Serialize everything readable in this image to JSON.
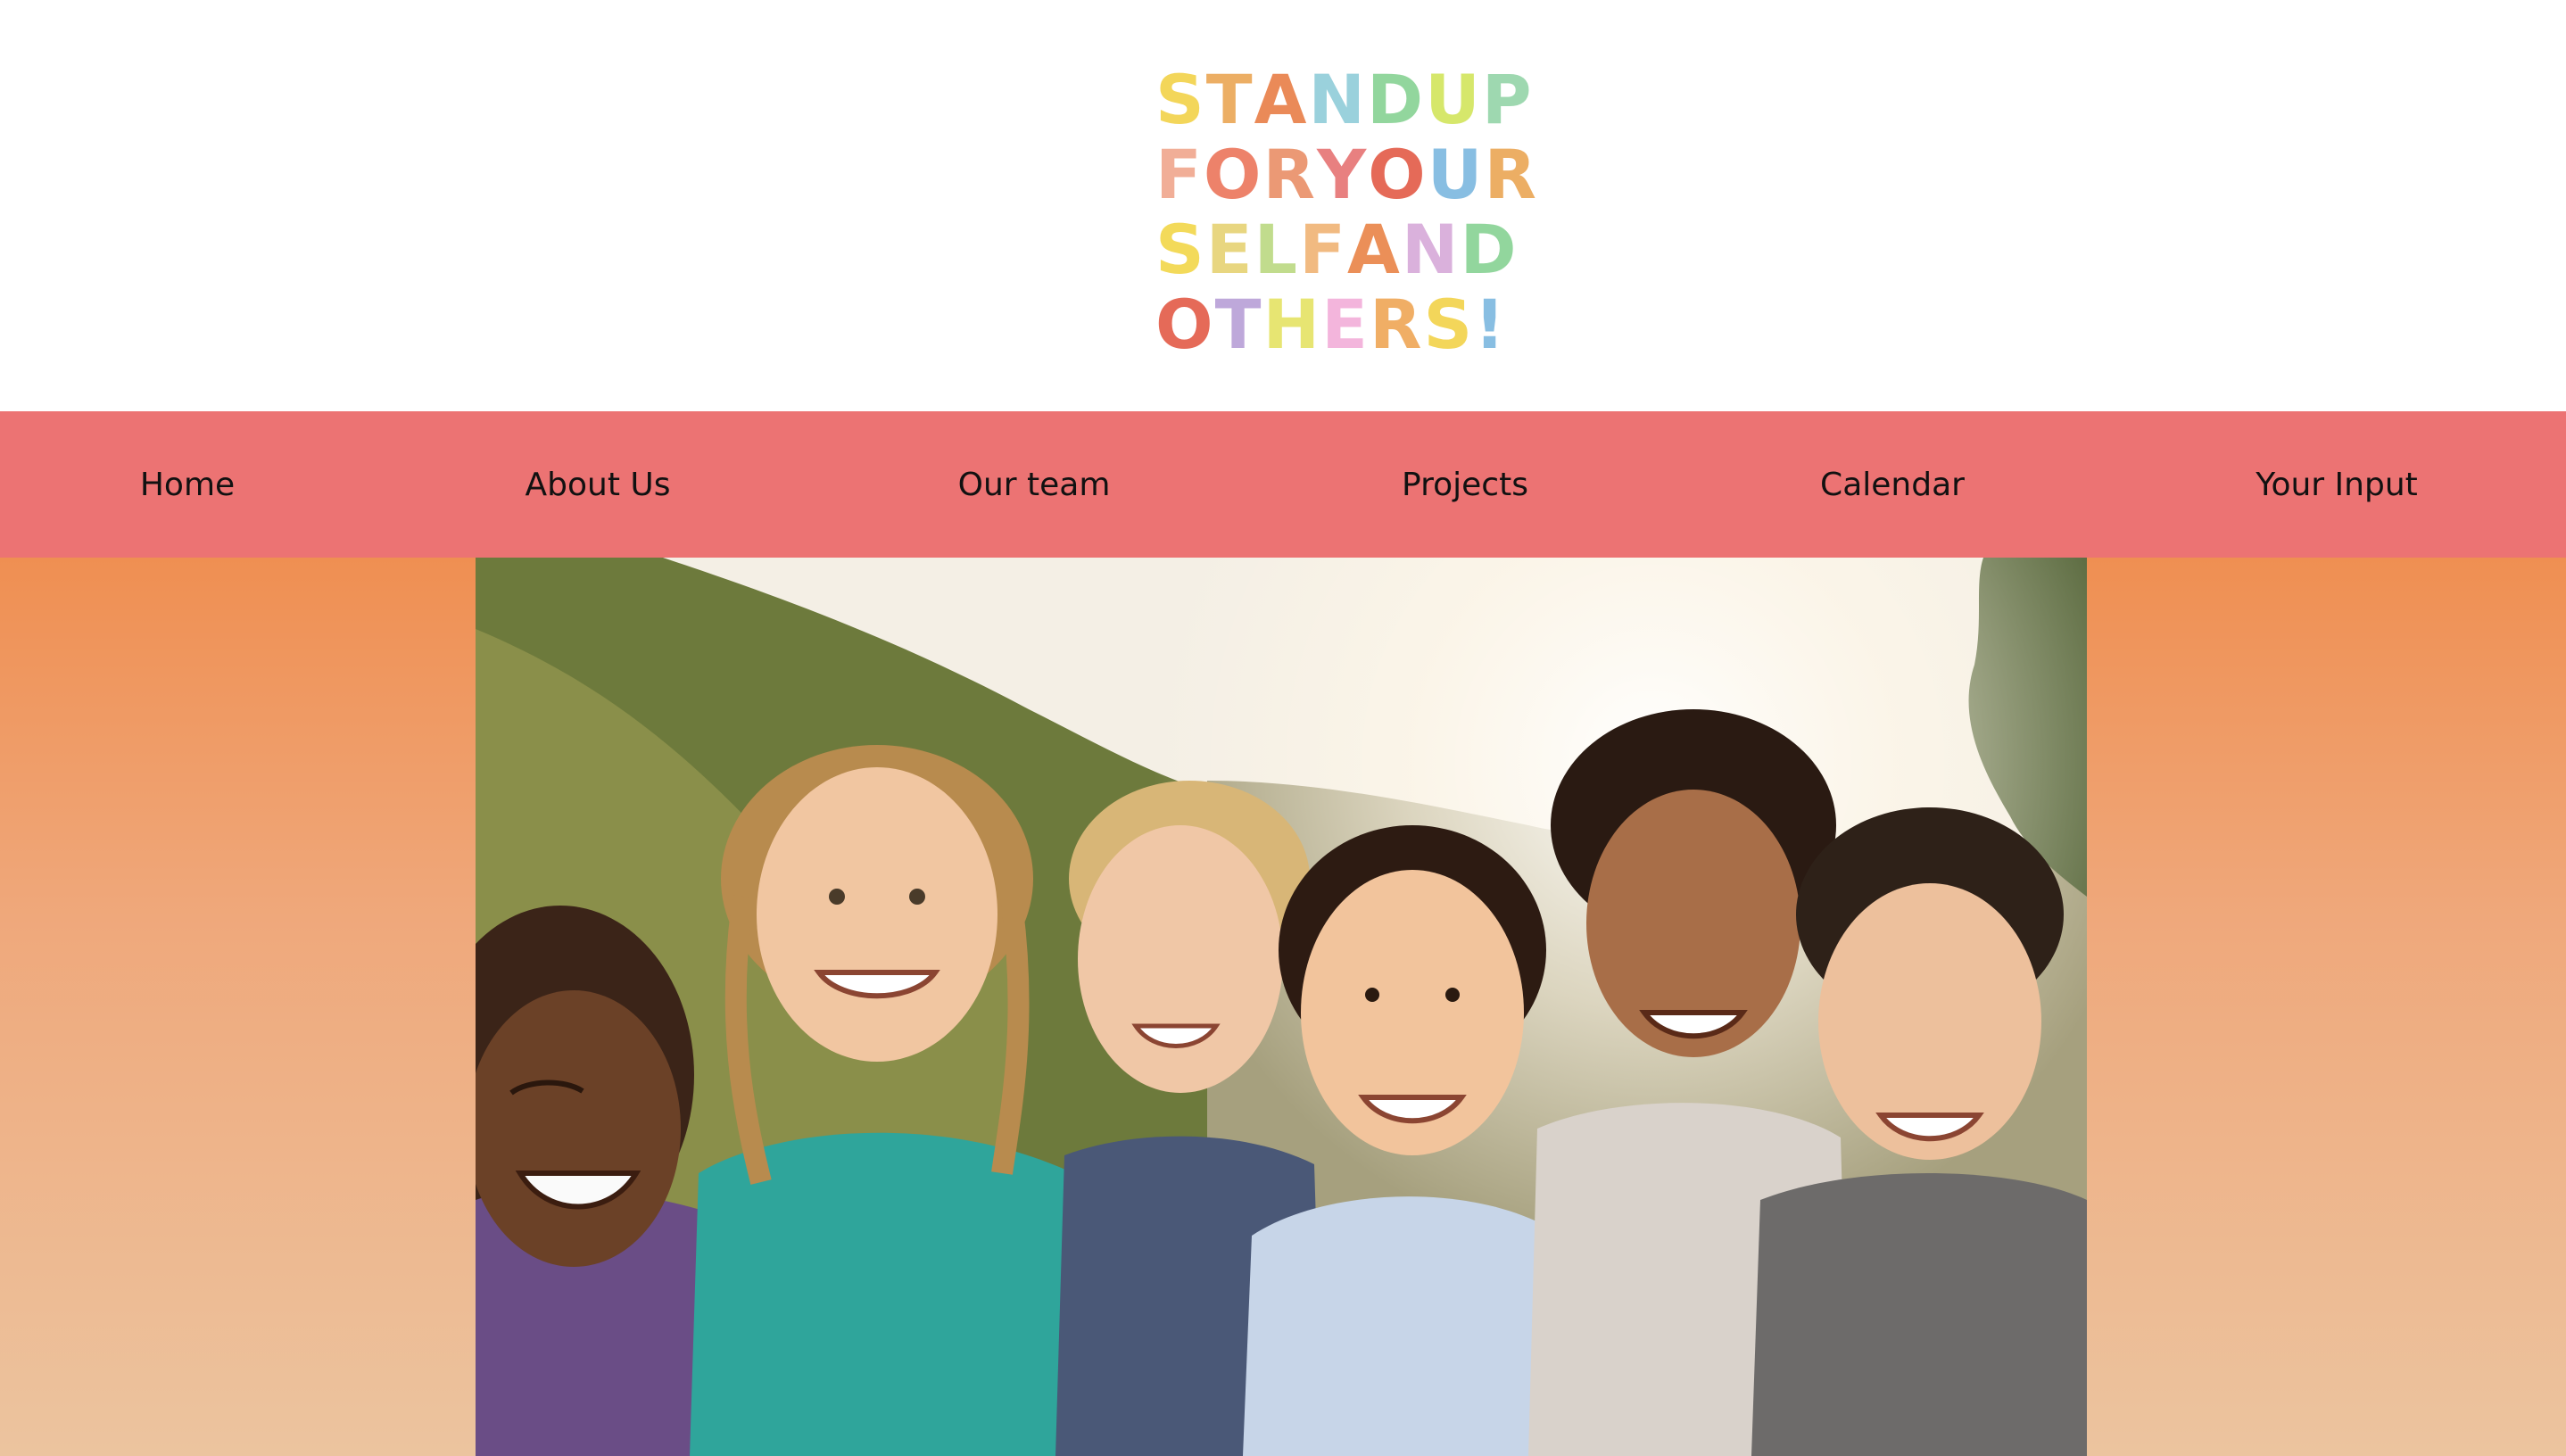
{
  "logo": {
    "alt": "Stand up for yourself and others!",
    "lines": [
      [
        {
          "ch": "S",
          "color": "#f2cf3e"
        },
        {
          "ch": "T",
          "color": "#e9a04a"
        },
        {
          "ch": "A",
          "color": "#e7763b"
        },
        {
          "ch": "N",
          "color": "#89c9d6"
        },
        {
          "ch": "D",
          "color": "#7fcf8c"
        },
        {
          "ch": " ",
          "color": ""
        },
        {
          "ch": "U",
          "color": "#cfe352"
        },
        {
          "ch": "P",
          "color": "#8ed2a3"
        }
      ],
      [
        {
          "ch": "F",
          "color": "#efa185"
        },
        {
          "ch": "O",
          "color": "#ea6d51"
        },
        {
          "ch": "R",
          "color": "#e8885d"
        },
        {
          "ch": " ",
          "color": ""
        },
        {
          "ch": "Y",
          "color": "#e46a6a"
        },
        {
          "ch": "O",
          "color": "#e1513b"
        },
        {
          "ch": "U",
          "color": "#74b3de"
        },
        {
          "ch": "R",
          "color": "#e9a04a"
        }
      ],
      [
        {
          "ch": "S",
          "color": "#f2d43e"
        },
        {
          "ch": "E",
          "color": "#e4cf6a"
        },
        {
          "ch": "L",
          "color": "#b7d67a"
        },
        {
          "ch": "F",
          "color": "#efae6c"
        },
        {
          "ch": " ",
          "color": ""
        },
        {
          "ch": "A",
          "color": "#e87c3b"
        },
        {
          "ch": "N",
          "color": "#d4a4d6"
        },
        {
          "ch": "D",
          "color": "#7fcf8c"
        }
      ],
      [
        {
          "ch": "O",
          "color": "#e1513b"
        },
        {
          "ch": "T",
          "color": "#b39ad4"
        },
        {
          "ch": "H",
          "color": "#e3e15a"
        },
        {
          "ch": "E",
          "color": "#f2a9d6"
        },
        {
          "ch": "R",
          "color": "#eea14b"
        },
        {
          "ch": "S",
          "color": "#f2cf3e"
        },
        {
          "ch": "!",
          "color": "#74b3de"
        }
      ]
    ]
  },
  "nav": {
    "items": [
      {
        "label": "Home",
        "name": "nav-home"
      },
      {
        "label": "About Us",
        "name": "nav-about-us"
      },
      {
        "label": "Our team",
        "name": "nav-our-team"
      },
      {
        "label": "Projects",
        "name": "nav-projects"
      },
      {
        "label": "Calendar",
        "name": "nav-calendar"
      },
      {
        "label": "Your Input",
        "name": "nav-your-input"
      }
    ]
  },
  "hero": {
    "photo_alt": "Group of smiling children outdoors"
  },
  "colors": {
    "nav_bg": "#ec7373",
    "hero_gradient_top": "#ef8f52",
    "hero_gradient_bottom": "#ecc49f"
  }
}
